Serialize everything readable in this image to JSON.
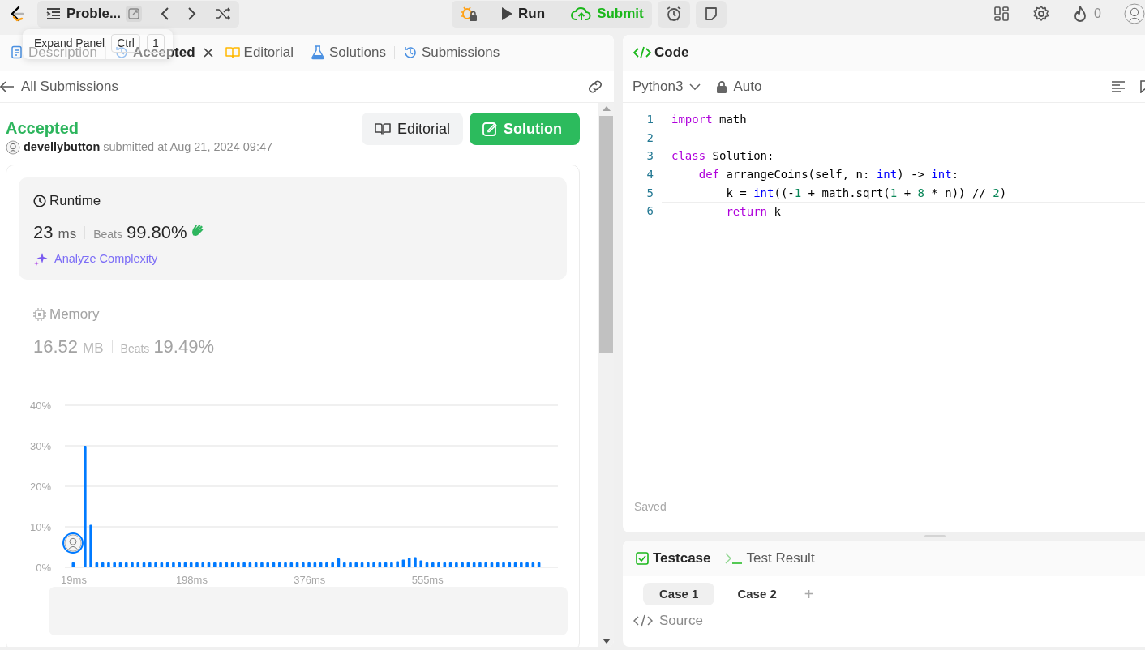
{
  "topbar": {
    "problem_title": "Proble...",
    "run": "Run",
    "submit": "Submit",
    "streak": "0"
  },
  "tooltip": {
    "label": "Expand Panel",
    "keys": [
      "Ctrl",
      "1"
    ]
  },
  "tabs": [
    {
      "label": "Description",
      "selected": false,
      "closable": false
    },
    {
      "label": "Accepted",
      "selected": true,
      "closable": true
    },
    {
      "label": "Editorial",
      "selected": false,
      "closable": false
    },
    {
      "label": "Solutions",
      "selected": false,
      "closable": false
    },
    {
      "label": "Submissions",
      "selected": false,
      "closable": false
    }
  ],
  "back_link": "All Submissions",
  "submission": {
    "status": "Accepted",
    "user": "devellybutton",
    "submitted": "submitted at Aug 21, 2024 09:47",
    "editorial_button": "Editorial",
    "solution_button": "Solution"
  },
  "runtime": {
    "title": "Runtime",
    "value": "23",
    "unit": "ms",
    "beats_label": "Beats",
    "beats": "99.80%",
    "analyze": "Analyze Complexity",
    "selected": true
  },
  "memory": {
    "title": "Memory",
    "value": "16.52",
    "unit": "MB",
    "beats_label": "Beats",
    "beats": "19.49%",
    "selected": false
  },
  "chart_data": {
    "type": "bar",
    "ylim": [
      0,
      40
    ],
    "yticks": [
      {
        "value": 0,
        "label": "0%"
      },
      {
        "value": 10,
        "label": "10%"
      },
      {
        "value": 20,
        "label": "20%"
      },
      {
        "value": 30,
        "label": "30%"
      },
      {
        "value": 40,
        "label": "40%"
      }
    ],
    "grid": true,
    "categories": [
      "19ms",
      null,
      null,
      null,
      null,
      null,
      null,
      null,
      null,
      null,
      null,
      null,
      null,
      null,
      null,
      null,
      null,
      null,
      null,
      null,
      "198ms",
      null,
      null,
      null,
      null,
      null,
      null,
      null,
      null,
      null,
      null,
      null,
      null,
      null,
      null,
      null,
      null,
      null,
      null,
      null,
      "376ms",
      null,
      null,
      null,
      null,
      null,
      null,
      null,
      null,
      null,
      null,
      null,
      null,
      null,
      null,
      null,
      null,
      null,
      null,
      null,
      "555ms",
      null,
      null,
      null,
      null,
      null,
      null,
      null,
      null,
      null,
      null,
      null,
      null,
      null,
      null,
      null,
      null,
      null,
      null,
      null
    ],
    "series": [
      {
        "color": "#007aff",
        "values": [
          1.2,
          null,
          30,
          10.5,
          1.2,
          1.2,
          1.2,
          1.2,
          1.2,
          1.2,
          1.2,
          1.2,
          1.2,
          1.2,
          1.2,
          1.2,
          1.2,
          1.2,
          1.2,
          1.2,
          1.2,
          1.2,
          1.2,
          1.2,
          1.2,
          1.2,
          1.2,
          1.2,
          1.2,
          1.2,
          1.2,
          1.2,
          1.2,
          1.2,
          1.2,
          1.2,
          1.2,
          1.2,
          1.2,
          1.2,
          1.2,
          1.2,
          1.2,
          1.2,
          1.2,
          2.2,
          1.2,
          1.2,
          1.2,
          1.2,
          1.2,
          1.2,
          1.2,
          1.2,
          1.2,
          1.5,
          1.9,
          2.3,
          2.5,
          1.7,
          1.2,
          1.2,
          1.2,
          1.2,
          1.2,
          1.2,
          1.2,
          1.2,
          1.2,
          1.2,
          1.2,
          1.2,
          1.2,
          1.2,
          1.2,
          1.2,
          1.2,
          1.2,
          1.2,
          1.2
        ]
      }
    ]
  },
  "code_panel": {
    "title": "Code",
    "language": "Python3",
    "mode": "Auto",
    "status": "Saved",
    "lines": [
      {
        "number": "1",
        "current": false,
        "tokens": [
          {
            "text": "import",
            "kind": "keyword"
          },
          {
            "text": " math",
            "kind": "plain"
          }
        ]
      },
      {
        "number": "2",
        "current": false
      },
      {
        "number": "3",
        "current": false,
        "tokens": [
          {
            "text": "class",
            "kind": "keyword"
          },
          {
            "text": " Solution:",
            "kind": "plain"
          }
        ]
      },
      {
        "number": "4",
        "current": false,
        "tokens": [
          {
            "text": "    def",
            "kind": "keyword"
          },
          {
            "text": " arrangeCoins(self, n: ",
            "kind": "plain"
          },
          {
            "text": "int",
            "kind": "type"
          },
          {
            "text": ") -> ",
            "kind": "plain"
          },
          {
            "text": "int",
            "kind": "type"
          },
          {
            "text": ":",
            "kind": "plain"
          }
        ]
      },
      {
        "number": "5",
        "current": false,
        "tokens": [
          {
            "text": "        k = ",
            "kind": "plain"
          },
          {
            "text": "int",
            "kind": "type"
          },
          {
            "text": "((-",
            "kind": "plain"
          },
          {
            "text": "1",
            "kind": "number"
          },
          {
            "text": " + math.sqrt(",
            "kind": "plain"
          },
          {
            "text": "1",
            "kind": "number"
          },
          {
            "text": " + ",
            "kind": "plain"
          },
          {
            "text": "8",
            "kind": "number"
          },
          {
            "text": " * n)) // ",
            "kind": "plain"
          },
          {
            "text": "2",
            "kind": "number"
          },
          {
            "text": ")",
            "kind": "plain"
          }
        ]
      },
      {
        "number": "6",
        "current": true,
        "tokens": [
          {
            "text": "        return",
            "kind": "keyword"
          },
          {
            "text": " k",
            "kind": "plain"
          }
        ]
      }
    ]
  },
  "test_panel": {
    "tabs": [
      {
        "label": "Testcase",
        "selected": true
      },
      {
        "label": "Test Result",
        "selected": false
      }
    ],
    "cases": [
      {
        "label": "Case 1",
        "selected": true
      },
      {
        "label": "Case 2",
        "selected": false
      }
    ],
    "add": "+",
    "source": "Source"
  }
}
